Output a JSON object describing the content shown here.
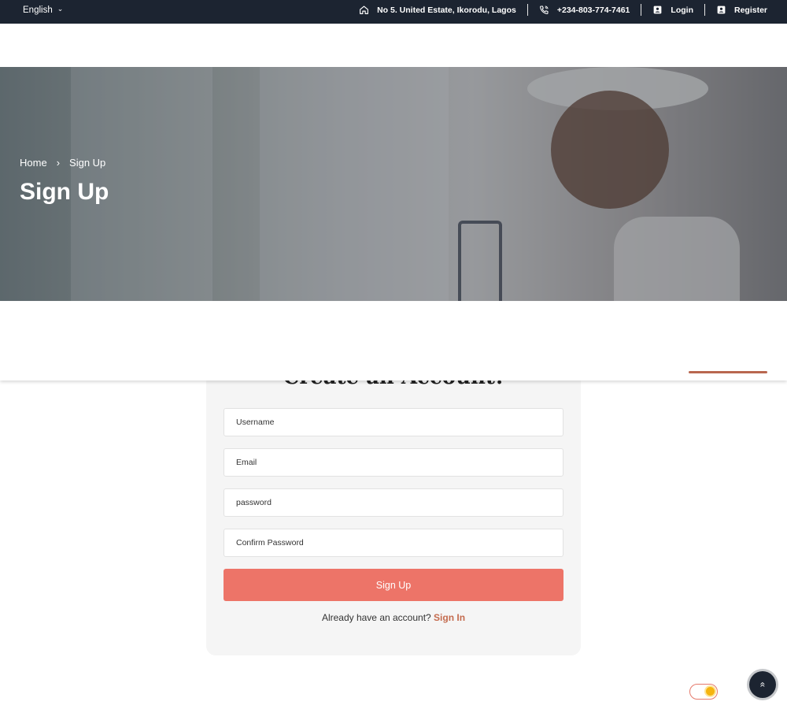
{
  "topbar": {
    "language": "English",
    "address": "No 5. United Estate, Ikorodu, Lagos",
    "phone": "+234-803-774-7461",
    "login_label": "Login",
    "register_label": "Register"
  },
  "hero": {
    "breadcrumb": [
      "Home",
      "Sign Up"
    ],
    "title": "Sign Up"
  },
  "form": {
    "title": "Create an Account!",
    "fields": {
      "username_placeholder": "Username",
      "email_placeholder": "Email",
      "password_placeholder": "password",
      "confirm_placeholder": "Confirm Password"
    },
    "submit_label": "Sign Up",
    "signin_prompt": "Already have an account?",
    "signin_link": "Sign In"
  },
  "colors": {
    "topbar_bg": "#1c2431",
    "accent": "#ed7468",
    "link": "#c46b4e",
    "card_bg": "#f5f5f5"
  },
  "icons": {
    "language_dropdown": "chevron-down-icon",
    "address": "home-icon",
    "phone": "phone-icon",
    "login": "user-badge-icon",
    "register": "user-badge-icon",
    "back_to_top": "chevron-up-double-icon",
    "theme_toggle": "sun-icon"
  }
}
